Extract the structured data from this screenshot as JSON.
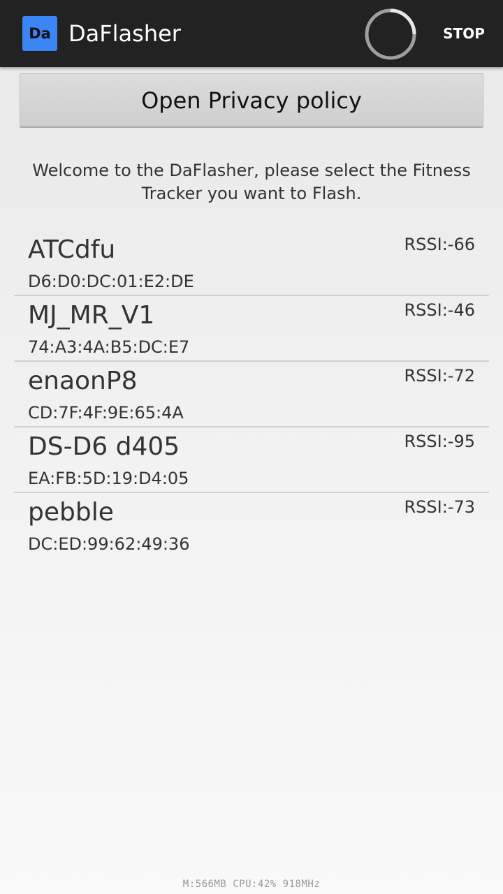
{
  "colors": {
    "action_bar": "#222222",
    "app_icon_bg": "#3b86f5",
    "title_text": "#ffffff",
    "body_text": "#333333",
    "divider": "#d0d0d0"
  },
  "action_bar": {
    "icon_text": "Da",
    "title": "DaFlasher",
    "spinner_icon": "progress-spinner",
    "stop_label": "STOP"
  },
  "privacy_button_label": "Open Privacy policy",
  "welcome_text": "Welcome to the DaFlasher, please select the Fitness Tracker you want to Flash.",
  "devices": [
    {
      "name": "ATCdfu",
      "mac": "D6:D0:DC:01:E2:DE",
      "rssi": "RSSI:-66"
    },
    {
      "name": "MJ_MR_V1",
      "mac": "74:A3:4A:B5:DC:E7",
      "rssi": "RSSI:-46"
    },
    {
      "name": "enaonP8",
      "mac": "CD:7F:4F:9E:65:4A",
      "rssi": "RSSI:-72"
    },
    {
      "name": "DS-D6 d405",
      "mac": "EA:FB:5D:19:D4:05",
      "rssi": "RSSI:-95"
    },
    {
      "name": "pebble",
      "mac": "DC:ED:99:62:49:36",
      "rssi": "RSSI:-73"
    }
  ],
  "debug_stats": "M:566MB CPU:42%  918MHz"
}
